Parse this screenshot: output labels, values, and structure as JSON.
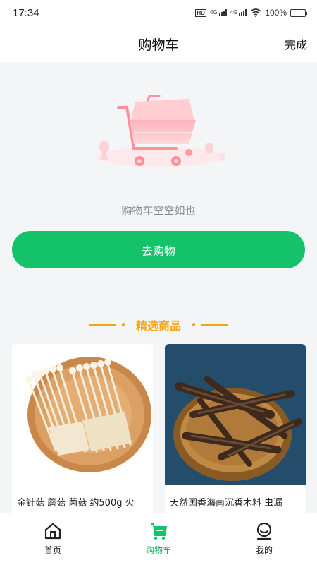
{
  "status_bar": {
    "time": "17:34",
    "hd": "HD",
    "network_1": "4G",
    "network_2": "4G",
    "battery": "100%",
    "icons": [
      "hd-icon",
      "signal-icon",
      "signal-icon",
      "wifi-icon",
      "battery-icon"
    ]
  },
  "header": {
    "title": "购物车",
    "action": "完成"
  },
  "empty_state": {
    "illustration": "shopping-cart-illustration",
    "message": "购物车空空如也",
    "button_label": "去购物"
  },
  "featured": {
    "title": "精选商品",
    "products": [
      {
        "name": "金针菇 蘑菇 菌菇 约500g 火",
        "image": "enoki-mushroom-photo"
      },
      {
        "name": "天然国香海南沉香木料 虫漏",
        "image": "agarwood-photo"
      }
    ]
  },
  "tab_bar": {
    "tabs": [
      {
        "label": "首页",
        "icon": "home-icon",
        "active": false
      },
      {
        "label": "购物车",
        "icon": "cart-icon",
        "active": true
      },
      {
        "label": "我的",
        "icon": "profile-icon",
        "active": false
      }
    ],
    "active_color": "#14a85b",
    "accent_color": "#14c26a",
    "section_color": "#f3a51a"
  }
}
